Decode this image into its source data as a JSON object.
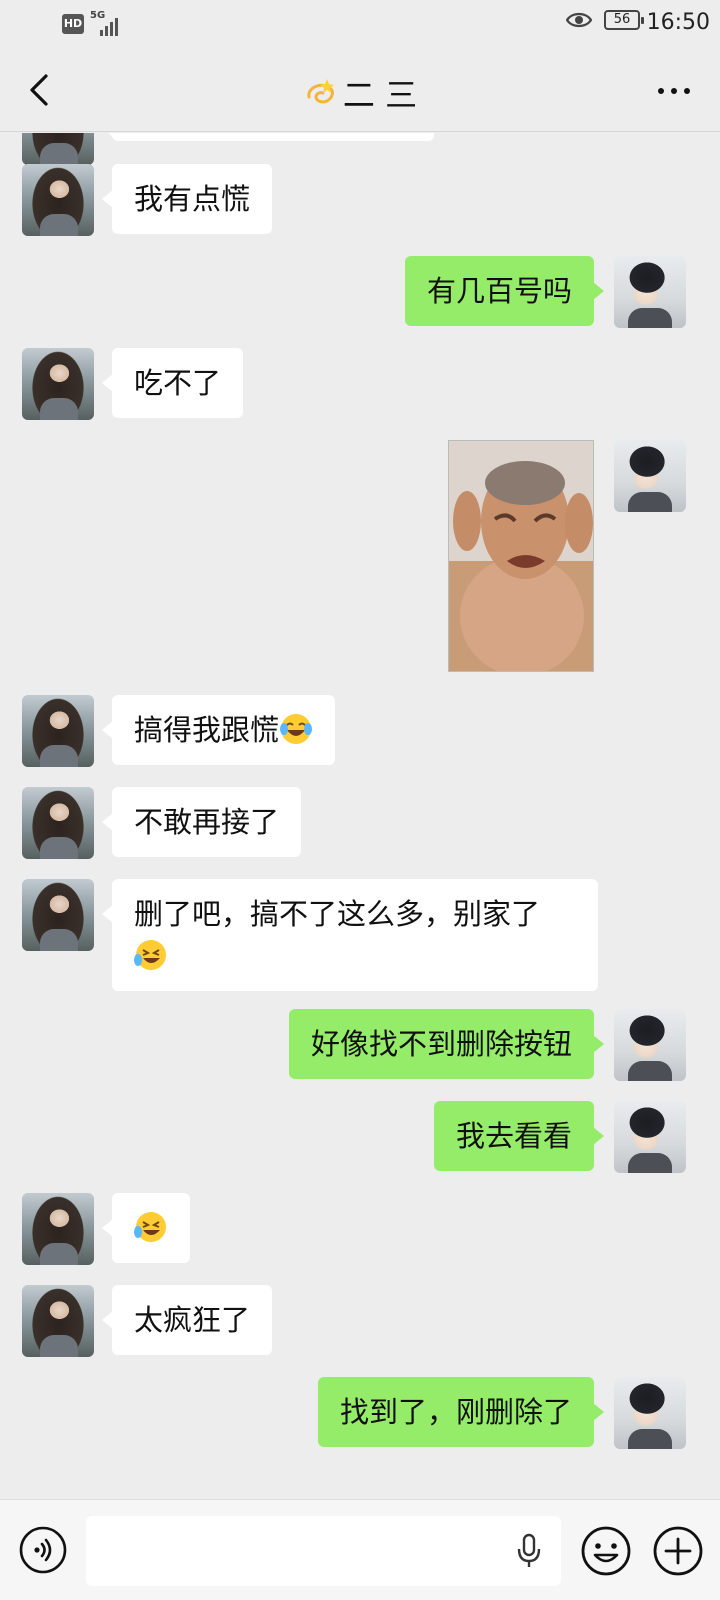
{
  "status": {
    "hd_label": "HD",
    "network": "5G",
    "battery": "56",
    "time": "16:50"
  },
  "header": {
    "title": "二 三",
    "title_icon": "dizzy-icon",
    "back_icon": "chevron-left-icon",
    "more_icon": "more-dots-icon"
  },
  "messages": [
    {
      "side": "left",
      "text": "我有点慌"
    },
    {
      "side": "right",
      "text": "有几百号吗"
    },
    {
      "side": "left",
      "text": "吃不了"
    },
    {
      "side": "right",
      "type": "sticker",
      "icon": "crying-man-sticker"
    },
    {
      "side": "left",
      "text": "搞得我跟慌",
      "emoji": "tears-of-joy-emoji"
    },
    {
      "side": "left",
      "text": "不敢再接了"
    },
    {
      "side": "left",
      "text": "删了吧，搞不了这么多，别家了",
      "emoji": "rolling-laughing-emoji"
    },
    {
      "side": "right",
      "text": "好像找不到删除按钮"
    },
    {
      "side": "right",
      "text": "我去看看"
    },
    {
      "side": "left",
      "emoji": "rolling-laughing-emoji"
    },
    {
      "side": "left",
      "text": "太疯狂了"
    },
    {
      "side": "right",
      "text": "找到了，刚删除了"
    }
  ],
  "input_bar": {
    "value": "",
    "voice_icon": "voice-icon",
    "mic_icon": "microphone-icon",
    "emoji_icon": "smiley-icon",
    "plus_icon": "plus-circle-icon"
  },
  "colors": {
    "background": "#ededed",
    "my_bubble": "#95ec69",
    "their_bubble": "#ffffff"
  }
}
